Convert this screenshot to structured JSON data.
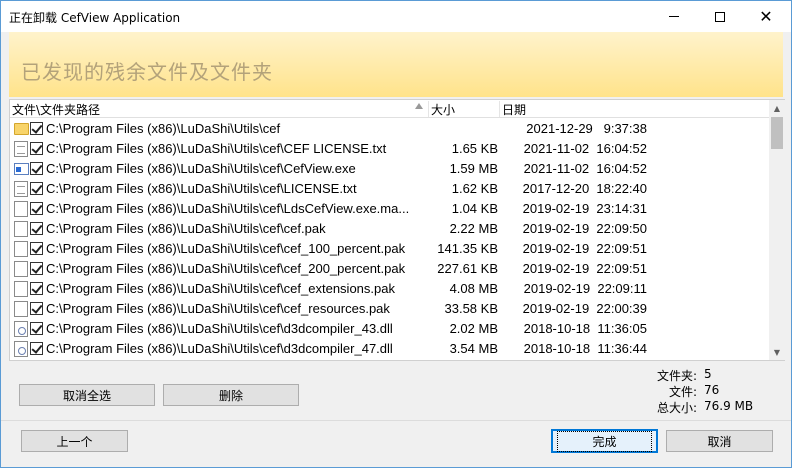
{
  "window": {
    "title": "正在卸载 CefView Application"
  },
  "banner": {
    "heading": "已发现的残余文件及文件夹"
  },
  "list": {
    "columns": {
      "path": "文件\\文件夹路径",
      "size": "大小",
      "date": "日期"
    },
    "rows": [
      {
        "icon": "folder-icon",
        "path": "C:\\Program Files (x86)\\LuDaShi\\Utils\\cef",
        "size": "",
        "date": "2021-12-29   9:37:38"
      },
      {
        "icon": "text-file-icon",
        "path": "C:\\Program Files (x86)\\LuDaShi\\Utils\\cef\\CEF LICENSE.txt",
        "size": "1.65 KB",
        "date": "2021-11-02  16:04:52"
      },
      {
        "icon": "exe-file-icon",
        "path": "C:\\Program Files (x86)\\LuDaShi\\Utils\\cef\\CefView.exe",
        "size": "1.59 MB",
        "date": "2021-11-02  16:04:52"
      },
      {
        "icon": "text-file-icon",
        "path": "C:\\Program Files (x86)\\LuDaShi\\Utils\\cef\\LICENSE.txt",
        "size": "1.62 KB",
        "date": "2017-12-20  18:22:40"
      },
      {
        "icon": "blank-file-icon",
        "path": "C:\\Program Files (x86)\\LuDaShi\\Utils\\cef\\LdsCefView.exe.ma...",
        "size": "1.04 KB",
        "date": "2019-02-19  23:14:31"
      },
      {
        "icon": "blank-file-icon",
        "path": "C:\\Program Files (x86)\\LuDaShi\\Utils\\cef\\cef.pak",
        "size": "2.22 MB",
        "date": "2019-02-19  22:09:50"
      },
      {
        "icon": "blank-file-icon",
        "path": "C:\\Program Files (x86)\\LuDaShi\\Utils\\cef\\cef_100_percent.pak",
        "size": "141.35 KB",
        "date": "2019-02-19  22:09:51"
      },
      {
        "icon": "blank-file-icon",
        "path": "C:\\Program Files (x86)\\LuDaShi\\Utils\\cef\\cef_200_percent.pak",
        "size": "227.61 KB",
        "date": "2019-02-19  22:09:51"
      },
      {
        "icon": "blank-file-icon",
        "path": "C:\\Program Files (x86)\\LuDaShi\\Utils\\cef\\cef_extensions.pak",
        "size": "4.08 MB",
        "date": "2019-02-19  22:09:11"
      },
      {
        "icon": "blank-file-icon",
        "path": "C:\\Program Files (x86)\\LuDaShi\\Utils\\cef\\cef_resources.pak",
        "size": "33.58 KB",
        "date": "2019-02-19  22:00:39"
      },
      {
        "icon": "dll-file-icon",
        "path": "C:\\Program Files (x86)\\LuDaShi\\Utils\\cef\\d3dcompiler_43.dll",
        "size": "2.02 MB",
        "date": "2018-10-18  11:36:05"
      },
      {
        "icon": "dll-file-icon",
        "path": "C:\\Program Files (x86)\\LuDaShi\\Utils\\cef\\d3dcompiler_47.dll",
        "size": "3.54 MB",
        "date": "2018-10-18  11:36:44"
      }
    ]
  },
  "actions": {
    "deselect_all": "取消全选",
    "delete": "删除"
  },
  "stats": {
    "folders_label": "文件夹:",
    "folders_value": "5",
    "files_label": "文件:",
    "files_value": "76",
    "total_label": "总大小:",
    "total_value": "76.9 MB"
  },
  "footer": {
    "back": "上一个",
    "finish": "完成",
    "cancel": "取消"
  }
}
